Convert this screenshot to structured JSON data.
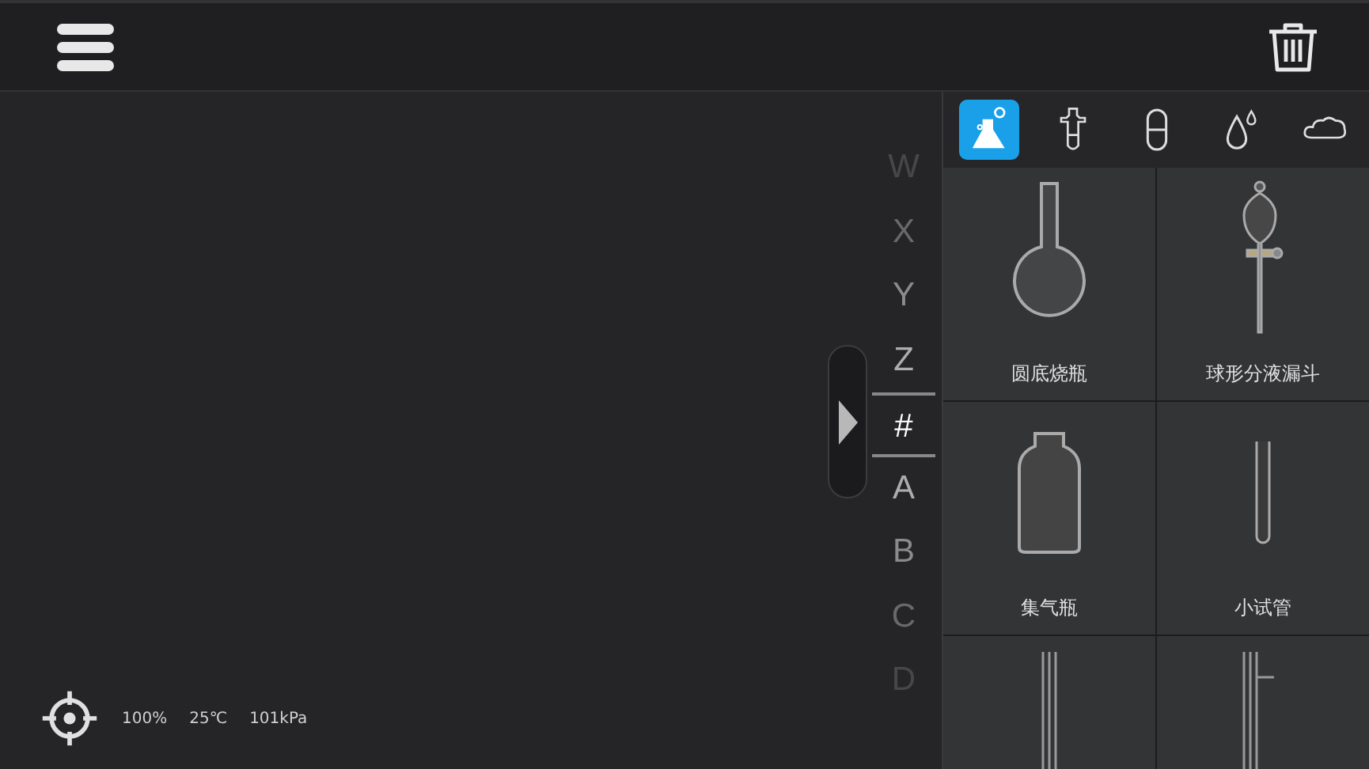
{
  "index_bar": {
    "letters": [
      {
        "label": "W",
        "selected": false
      },
      {
        "label": "X",
        "selected": false
      },
      {
        "label": "Y",
        "selected": false
      },
      {
        "label": "Z",
        "selected": false
      },
      {
        "label": "#",
        "selected": true
      },
      {
        "label": "A",
        "selected": false
      },
      {
        "label": "B",
        "selected": false
      },
      {
        "label": "C",
        "selected": false
      },
      {
        "label": "D",
        "selected": false
      }
    ]
  },
  "category_tabs": [
    {
      "selected": true
    },
    {
      "selected": false
    },
    {
      "selected": false
    },
    {
      "selected": false
    },
    {
      "selected": false
    }
  ],
  "apparatus": [
    {
      "kind": "flask",
      "label": "圆底烧瓶"
    },
    {
      "kind": "funnel",
      "label": "球形分液漏斗"
    },
    {
      "kind": "bottle",
      "label": "集气瓶"
    },
    {
      "kind": "tube",
      "label": "小试管"
    },
    {
      "kind": "pipe"
    },
    {
      "kind": "sidearm"
    }
  ],
  "status": {
    "zoom": "100%",
    "temperature": "25℃",
    "pressure": "101kPa"
  }
}
